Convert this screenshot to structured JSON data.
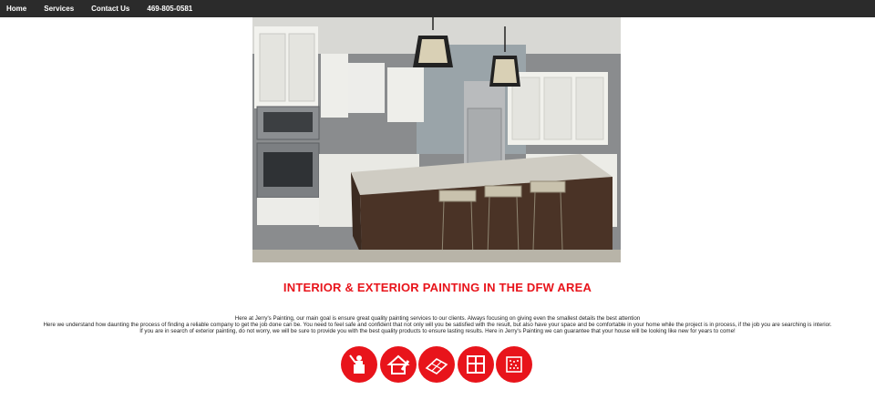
{
  "nav": {
    "items": [
      {
        "label": "Home"
      },
      {
        "label": "Services"
      },
      {
        "label": "Contact Us"
      },
      {
        "label": "469-805-0581"
      }
    ]
  },
  "hero": {
    "image": "kitchen-photo"
  },
  "headline": "INTERIOR & EXTERIOR PAINTING IN THE DFW AREA",
  "intro": [
    "Here at Jerry's Painting, our main goal is ensure great quality painting services to our clients. Always focusing on giving even the smallest details the best attention",
    "Here we understand how daunting the process of finding a reliable company to get the job done can be. You need to feel safe and confident that not only will you be satisfied with the result, but also have your space and be comfortable in your home while the project is in process, if the job you are searching is interior.",
    "If you are in search of exterior painting, do not worry, we will be sure to provide you with the best quality products to ensure lasting results. Here in Jerry's Painting we can guarantee that your house will be looking like new for years to come!"
  ],
  "service_icons": [
    {
      "name": "painter-icon"
    },
    {
      "name": "house-paint-icon"
    },
    {
      "name": "flooring-icon"
    },
    {
      "name": "cabinet-icon"
    },
    {
      "name": "texture-icon"
    }
  ],
  "colors": {
    "accent": "#e8141b",
    "navbar": "#2b2b2b"
  }
}
